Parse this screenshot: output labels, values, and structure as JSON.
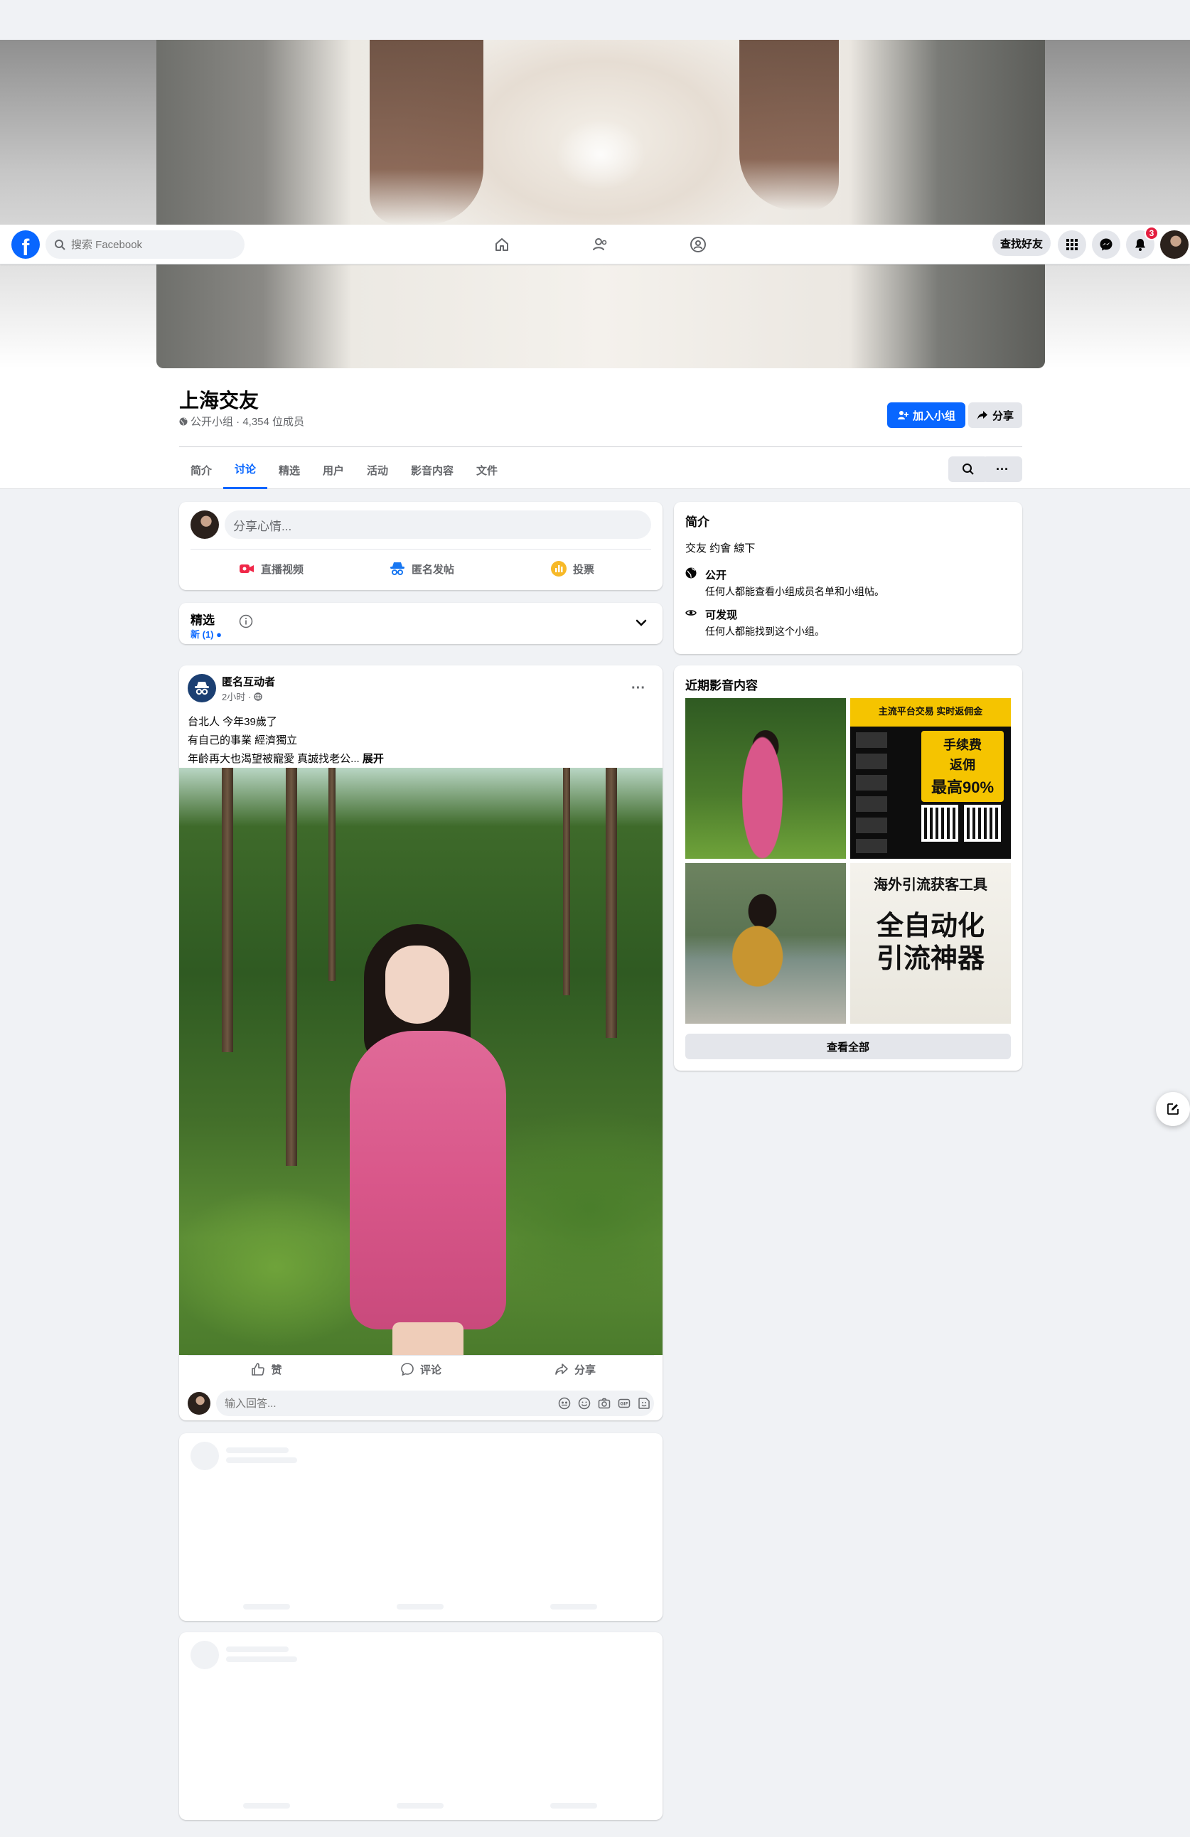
{
  "topnav": {
    "logo_letter": "f",
    "search_placeholder": "搜索 Facebook",
    "find_friends": "查找好友",
    "notification_count": "3",
    "icons": [
      "home-icon",
      "friends-icon",
      "groups-icon",
      "apps-grid-icon",
      "messenger-icon",
      "bell-icon"
    ]
  },
  "group": {
    "title": "上海交友",
    "meta": "公开小组 · 4,354 位成员",
    "join_label": "加入小组",
    "share_label": "分享",
    "tabs": [
      {
        "label": "简介"
      },
      {
        "label": "讨论",
        "active": true
      },
      {
        "label": "精选"
      },
      {
        "label": "用户"
      },
      {
        "label": "活动"
      },
      {
        "label": "影音内容"
      },
      {
        "label": "文件"
      }
    ],
    "more_label": "···"
  },
  "composer": {
    "placeholder": "分享心情...",
    "actions": [
      {
        "label": "直播视频",
        "color": "#f02849"
      },
      {
        "label": "匿名发帖",
        "color": "#1877f2"
      },
      {
        "label": "投票",
        "color": "#f7b928"
      }
    ]
  },
  "featured": {
    "title": "精选",
    "new_label": "新 (1) ●"
  },
  "post": {
    "author": "匿名互动者",
    "time": "2小时 ·",
    "more": "···",
    "lines": [
      "台北人  今年39歲了",
      "有自己的事業   經濟獨立",
      "年齡再大也渴望被寵愛      真誠找老公..."
    ],
    "expand": "展开",
    "actions": [
      "赞",
      "评论",
      "分享"
    ],
    "comment_placeholder": "输入回答..."
  },
  "about": {
    "title": "简介",
    "description": "交友 约會 線下",
    "rows": [
      {
        "title": "公开",
        "subtitle": "任何人都能查看小组成员名单和小组帖。",
        "icon": "globe-icon"
      },
      {
        "title": "可发现",
        "subtitle": "任何人都能找到这个小组。",
        "icon": "eye-icon"
      }
    ]
  },
  "media": {
    "title": "近期影音内容",
    "view_all": "查看全部",
    "thumb2": {
      "banner": "主流平台交易 实时返佣金",
      "line1": "手续费",
      "line2": "返佣",
      "line3": "最高90%"
    },
    "thumb4": {
      "top": "海外引流获客工具",
      "mid1": "全自动化",
      "mid2": "引流神器"
    }
  },
  "colors": {
    "accent": "#0866ff",
    "badge": "#e41e3f",
    "background": "#f0f2f5"
  }
}
